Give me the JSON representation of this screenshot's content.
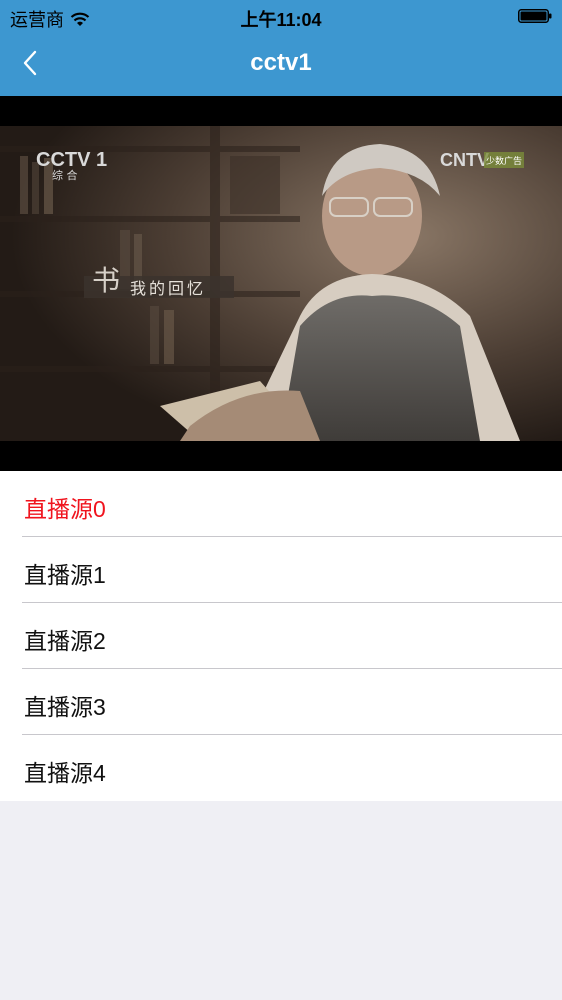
{
  "status_bar": {
    "carrier": "运营商",
    "time": "上午11:04"
  },
  "nav": {
    "title": "cctv1"
  },
  "video": {
    "channel_logo": "CCTV 1",
    "channel_sub": "综 合",
    "corner_logo": "CNTV",
    "corner_logo_tag": "少数广告",
    "program_title": "我的回忆",
    "program_glyph": "书"
  },
  "sources": [
    {
      "label": "直播源0",
      "active": true
    },
    {
      "label": "直播源1",
      "active": false
    },
    {
      "label": "直播源2",
      "active": false
    },
    {
      "label": "直播源3",
      "active": false
    },
    {
      "label": "直播源4",
      "active": false
    }
  ],
  "colors": {
    "header": "#3d97d0",
    "active_source": "#f0141e",
    "background": "#efeff4"
  }
}
